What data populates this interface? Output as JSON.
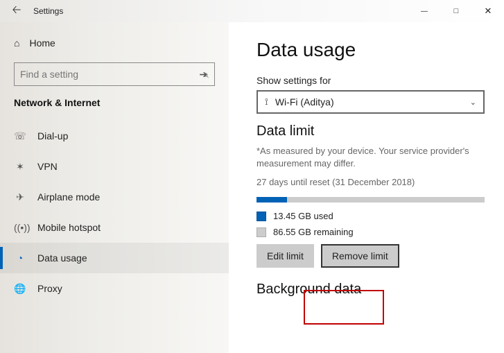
{
  "window": {
    "title": "Settings"
  },
  "sidebar": {
    "home": "Home",
    "search_placeholder": "Find a setting",
    "section": "Network & Internet",
    "items": [
      {
        "icon": "dialup-icon",
        "label": "Dial-up"
      },
      {
        "icon": "vpn-icon",
        "label": "VPN"
      },
      {
        "icon": "airplane-icon",
        "label": "Airplane mode"
      },
      {
        "icon": "hotspot-icon",
        "label": "Mobile hotspot"
      },
      {
        "icon": "datausage-icon",
        "label": "Data usage"
      },
      {
        "icon": "proxy-icon",
        "label": "Proxy"
      }
    ]
  },
  "main": {
    "title": "Data usage",
    "show_settings_for": "Show settings for",
    "adapter": "Wi-Fi (Aditya)",
    "data_limit_title": "Data limit",
    "note": "*As measured by your device. Your service provider's measurement may differ.",
    "reset_text": "27 days until reset (31 December 2018)",
    "used_text": "13.45 GB used",
    "remaining_text": "86.55 GB remaining",
    "progress_percent": 13.45,
    "edit_limit": "Edit limit",
    "remove_limit": "Remove limit",
    "background_title": "Background data",
    "colors": {
      "accent": "#0262b6",
      "bar_bg": "#cccccc"
    }
  }
}
